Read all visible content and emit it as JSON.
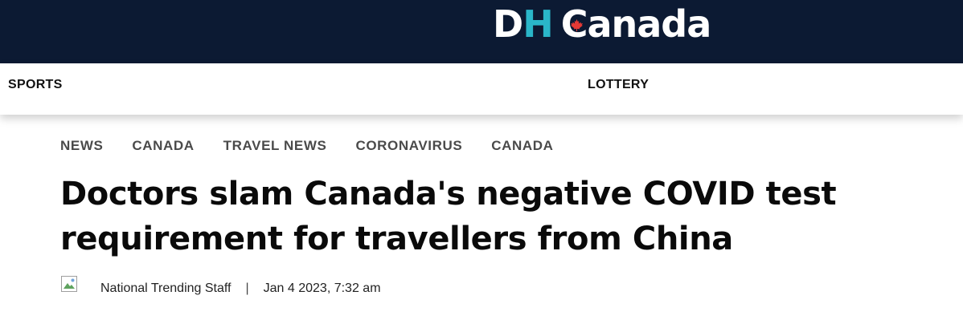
{
  "header": {
    "logo": {
      "d": "D",
      "h": "H",
      "c": "C",
      "rest": "anada",
      "accent_color": "#2ab6c9",
      "background_color": "#0c1a33",
      "icon": "maple-leaf-icon"
    }
  },
  "nav": {
    "items": [
      {
        "label": "SPORTS"
      },
      {
        "label": "LOTTERY"
      }
    ]
  },
  "breadcrumbs": [
    {
      "label": "NEWS"
    },
    {
      "label": "CANADA"
    },
    {
      "label": "TRAVEL NEWS"
    },
    {
      "label": "CORONAVIRUS"
    },
    {
      "label": "CANADA"
    }
  ],
  "article": {
    "headline": "Doctors slam Canada's negative COVID test requirement for travellers from China",
    "byline": {
      "avatar_icon": "broken-image-icon",
      "author": "National Trending Staff",
      "separator": "|",
      "date": "Jan 4 2023, 7:32 am"
    }
  }
}
